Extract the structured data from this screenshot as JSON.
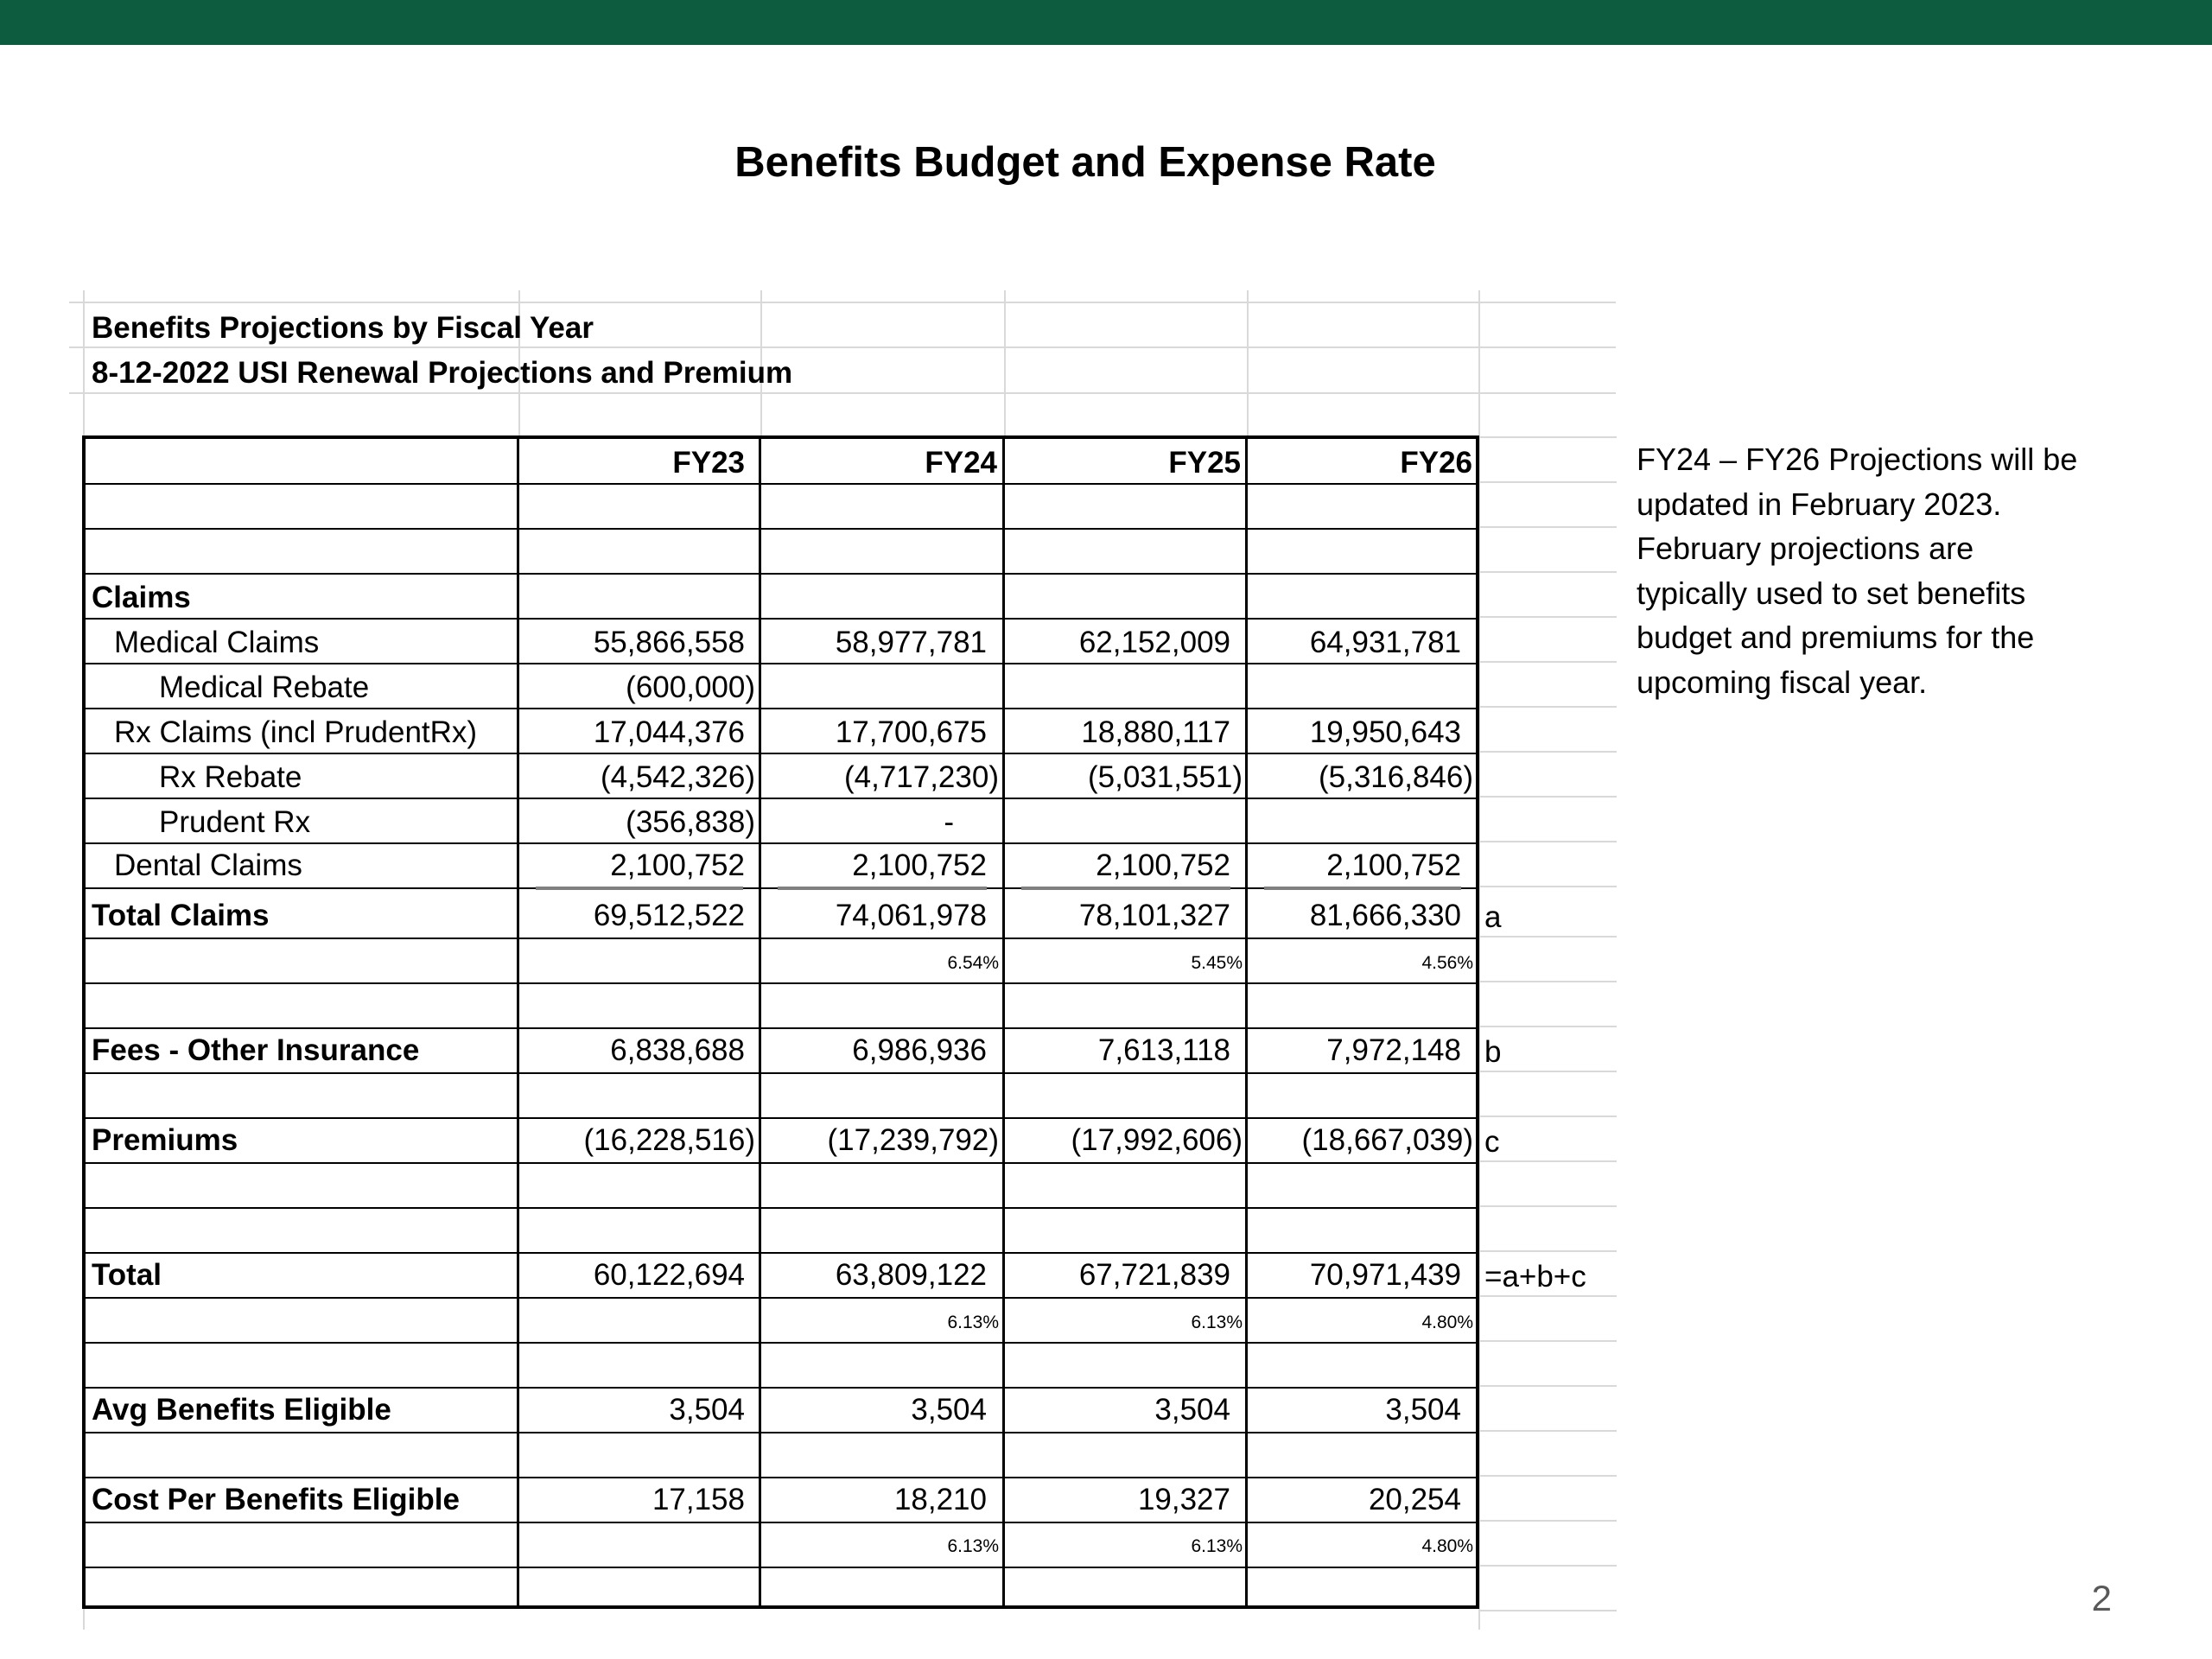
{
  "slide": {
    "title": "Benefits Budget and Expense Rate",
    "page_number": "2",
    "accent_color": "#0e5c3f"
  },
  "sheet": {
    "heading1": "Benefits Projections by Fiscal Year",
    "heading2": "8-12-2022 USI Renewal Projections and Premium",
    "columns": [
      "FY23",
      "FY24",
      "FY25",
      "FY26"
    ],
    "section_claims": "Claims",
    "rows": [
      {
        "label": "Medical Claims",
        "values": [
          "55,866,558",
          "58,977,781",
          "62,152,009",
          "64,931,781"
        ]
      },
      {
        "label": "Medical Rebate",
        "values": [
          "(600,000)",
          "",
          "",
          ""
        ]
      },
      {
        "label": "Rx Claims (incl PrudentRx)",
        "values": [
          "17,044,376",
          "17,700,675",
          "18,880,117",
          "19,950,643"
        ]
      },
      {
        "label": "Rx Rebate",
        "values": [
          "(4,542,326)",
          "(4,717,230)",
          "(5,031,551)",
          "(5,316,846)"
        ]
      },
      {
        "label": "Prudent Rx",
        "values": [
          "(356,838)",
          "-",
          "",
          ""
        ]
      },
      {
        "label": "Dental Claims",
        "values": [
          "2,100,752",
          "2,100,752",
          "2,100,752",
          "2,100,752"
        ]
      },
      {
        "label": "Total Claims",
        "values": [
          "69,512,522",
          "74,061,978",
          "78,101,327",
          "81,666,330"
        ],
        "note": "a"
      },
      {
        "label": "",
        "values": [
          "",
          "6.54%",
          "5.45%",
          "4.56%"
        ]
      },
      {
        "label": "Fees - Other Insurance",
        "values": [
          "6,838,688",
          "6,986,936",
          "7,613,118",
          "7,972,148"
        ],
        "note": "b"
      },
      {
        "label": "Premiums",
        "values": [
          "(16,228,516)",
          "(17,239,792)",
          "(17,992,606)",
          "(18,667,039)"
        ],
        "note": "c"
      },
      {
        "label": "Total",
        "values": [
          "60,122,694",
          "63,809,122",
          "67,721,839",
          "70,971,439"
        ],
        "note": "=a+b+c"
      },
      {
        "label": "",
        "values": [
          "",
          "6.13%",
          "6.13%",
          "4.80%"
        ]
      },
      {
        "label": "Avg Benefits Eligible",
        "values": [
          "3,504",
          "3,504",
          "3,504",
          "3,504"
        ]
      },
      {
        "label": "Cost Per Benefits Eligible",
        "values": [
          "17,158",
          "18,210",
          "19,327",
          "20,254"
        ]
      },
      {
        "label": "",
        "values": [
          "",
          "6.13%",
          "6.13%",
          "4.80%"
        ]
      }
    ]
  },
  "note_lines": [
    "FY24 – FY26 Projections will be",
    "updated in February 2023.",
    "February projections are",
    "typically used to set benefits",
    "budget and premiums for the",
    "upcoming fiscal year."
  ]
}
